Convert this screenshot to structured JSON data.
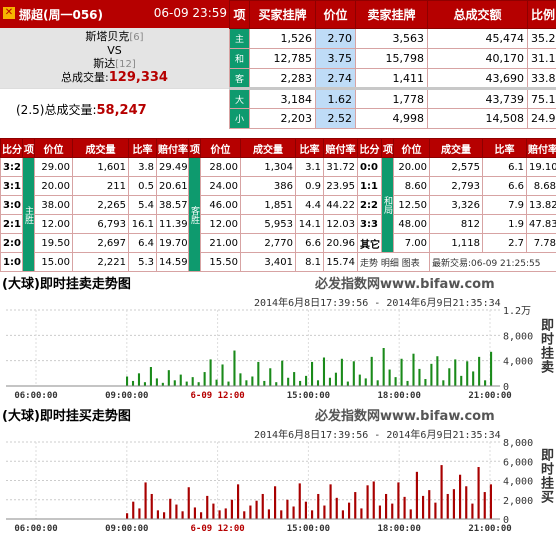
{
  "header": {
    "league": "挪超(周一056)",
    "datetime": "06-09 23:59",
    "home_team": "斯塔贝克",
    "home_rank": "[6]",
    "vs": "VS",
    "away_team": "斯达",
    "away_rank": "[12]",
    "total_label": "总成交量:",
    "total_value": "129,334",
    "ou_label": "(2.5)总成交量:",
    "ou_value": "58,247"
  },
  "market": {
    "columns": [
      "项",
      "买家挂牌",
      "价位",
      "卖家挂牌",
      "总成交额",
      "比例"
    ],
    "rows": [
      {
        "item": "主",
        "buy": "1,526",
        "price": "2.70",
        "sell": "3,563",
        "total": "45,474",
        "ratio": "35.2"
      },
      {
        "item": "和",
        "buy": "12,785",
        "price": "3.75",
        "sell": "15,798",
        "total": "40,170",
        "ratio": "31.1"
      },
      {
        "item": "客",
        "buy": "2,283",
        "price": "2.74",
        "sell": "1,411",
        "total": "43,690",
        "ratio": "33.8"
      },
      {
        "item": "大",
        "buy": "3,184",
        "price": "1.62",
        "sell": "1,778",
        "total": "43,739",
        "ratio": "75.1"
      },
      {
        "item": "小",
        "buy": "2,203",
        "price": "2.52",
        "sell": "4,998",
        "total": "14,508",
        "ratio": "24.9"
      }
    ]
  },
  "score_table": {
    "columns": [
      "比分",
      "项",
      "价位",
      "成交量",
      "比率",
      "赔付率",
      "项",
      "价位",
      "成交量",
      "比率",
      "赔付率",
      "比分",
      "项",
      "价位",
      "成交量",
      "比率",
      "赔付率"
    ],
    "group_labels": {
      "home": "主胜",
      "away": "客胜",
      "draw": "和局"
    },
    "rows": [
      [
        "3:2",
        "29.00",
        "1,601",
        "3.8",
        "29.49",
        "28.00",
        "1,304",
        "3.1",
        "31.72",
        "0:0",
        "20.00",
        "2,575",
        "6.1",
        "19.10"
      ],
      [
        "3:1",
        "20.00",
        "211",
        "0.5",
        "20.61",
        "24.00",
        "386",
        "0.9",
        "23.95",
        "1:1",
        "8.60",
        "2,793",
        "6.6",
        "8.68"
      ],
      [
        "3:0",
        "38.00",
        "2,265",
        "5.4",
        "38.57",
        "46.00",
        "1,851",
        "4.4",
        "44.22",
        "2:2",
        "12.50",
        "3,326",
        "7.9",
        "13.82"
      ],
      [
        "2:1",
        "12.00",
        "6,793",
        "16.1",
        "11.39",
        "12.00",
        "5,953",
        "14.1",
        "12.03",
        "3:3",
        "48.00",
        "812",
        "1.9",
        "47.83"
      ],
      [
        "2:0",
        "19.50",
        "2,697",
        "6.4",
        "19.70",
        "21.00",
        "2,770",
        "6.6",
        "20.96",
        "其它",
        "7.00",
        "1,118",
        "2.7",
        "7.78"
      ],
      [
        "1:0",
        "15.00",
        "2,221",
        "5.3",
        "14.59",
        "15.50",
        "3,401",
        "8.1",
        "15.74",
        "",
        "",
        "",
        "",
        ""
      ]
    ],
    "footer_links": "走势 明细 图表",
    "last_trade": "最新交易:06-09 21:25:55"
  },
  "chart1": {
    "title": "(大球)即时挂卖走势图",
    "site": "必发指数网www.bifaw.com",
    "range": "2014年6月8日17:39:56 - 2014年6月9日21:35:34",
    "ylabel": "即时挂卖",
    "color": "#1a8a1a"
  },
  "chart2": {
    "title": "(大球)即时挂买走势图",
    "site": "必发指数网www.bifaw.com",
    "range": "2014年6月8日17:39:56 - 2014年6月9日21:35:34",
    "ylabel": "即时挂买",
    "color": "#a80000"
  },
  "chart_data": [
    {
      "type": "bar",
      "title": "(大球)即时挂卖走势图",
      "ylabel": "即时挂卖",
      "x_ticks": [
        "06:00:00",
        "09:00:00",
        "6-09 12:00",
        "15:00:00",
        "18:00:00",
        "21:00:00"
      ],
      "y_ticks": [
        "1.2万",
        "8,000",
        "4,000",
        "0"
      ],
      "ylim": [
        0,
        12000
      ],
      "values": [
        1500,
        800,
        2000,
        600,
        3000,
        1200,
        500,
        2500,
        900,
        1800,
        700,
        1400,
        600,
        2200,
        4200,
        1000,
        3400,
        700,
        5600,
        2000,
        900,
        1500,
        3800,
        800,
        2800,
        600,
        4000,
        1300,
        2200,
        800,
        1600,
        3800,
        900,
        4500,
        1300,
        2100,
        4300,
        700,
        3900,
        1800,
        1200,
        4600,
        900,
        6000,
        2600,
        1400,
        4300,
        800,
        5100,
        2700,
        1100,
        3500,
        4700,
        900,
        2800,
        4200,
        1600,
        3900,
        2300,
        4600,
        900,
        5400
      ]
    },
    {
      "type": "bar",
      "title": "(大球)即时挂买走势图",
      "ylabel": "即时挂买",
      "x_ticks": [
        "06:00:00",
        "09:00:00",
        "6-09 12:00",
        "15:00:00",
        "18:00:00",
        "21:00:00"
      ],
      "y_ticks": [
        "8,000",
        "6,000",
        "4,000",
        "2,000",
        "0"
      ],
      "ylim": [
        0,
        8000
      ],
      "values": [
        600,
        1800,
        1100,
        3800,
        2600,
        900,
        700,
        2100,
        1500,
        800,
        3300,
        1200,
        700,
        2400,
        1600,
        900,
        1100,
        2000,
        3600,
        800,
        1400,
        1900,
        2600,
        1000,
        3400,
        900,
        2000,
        1300,
        3700,
        1800,
        900,
        2600,
        1400,
        3600,
        2200,
        900,
        1700,
        2800,
        1100,
        3500,
        3900,
        1400,
        2600,
        1600,
        3800,
        2300,
        1000,
        4900,
        2400,
        3000,
        1700,
        5600,
        2600,
        3100,
        4600,
        3400,
        1600,
        5400,
        2800,
        3600
      ]
    }
  ]
}
